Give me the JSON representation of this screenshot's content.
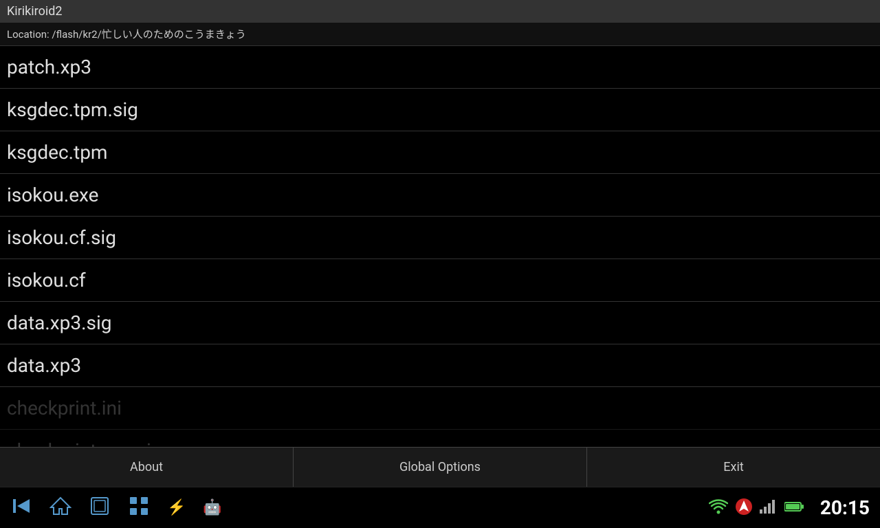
{
  "titleBar": {
    "title": "Kirikiroid2"
  },
  "locationBar": {
    "label": "Location: /flash/kr2/忙しい人のためのこうまきょう"
  },
  "fileList": {
    "items": [
      {
        "name": "patch.xp3"
      },
      {
        "name": "ksgdec.tpm.sig"
      },
      {
        "name": "ksgdec.tpm"
      },
      {
        "name": "isokou.exe"
      },
      {
        "name": "isokou.cf.sig"
      },
      {
        "name": "isokou.cf"
      },
      {
        "name": "data.xp3.sig"
      },
      {
        "name": "data.xp3"
      }
    ],
    "partialItems": [
      {
        "name": "checkprint.ini"
      },
      {
        "name": "checkprint.exe.sig"
      }
    ]
  },
  "menuBar": {
    "buttons": [
      {
        "id": "about",
        "label": "About"
      },
      {
        "id": "global-options",
        "label": "Global Options"
      },
      {
        "id": "exit",
        "label": "Exit"
      }
    ]
  },
  "navBar": {
    "time": "20:15",
    "icons": {
      "back": "◁",
      "home": "△",
      "recents": "□",
      "grid": "⊞",
      "usb": "⚡",
      "android": "🤖"
    }
  }
}
